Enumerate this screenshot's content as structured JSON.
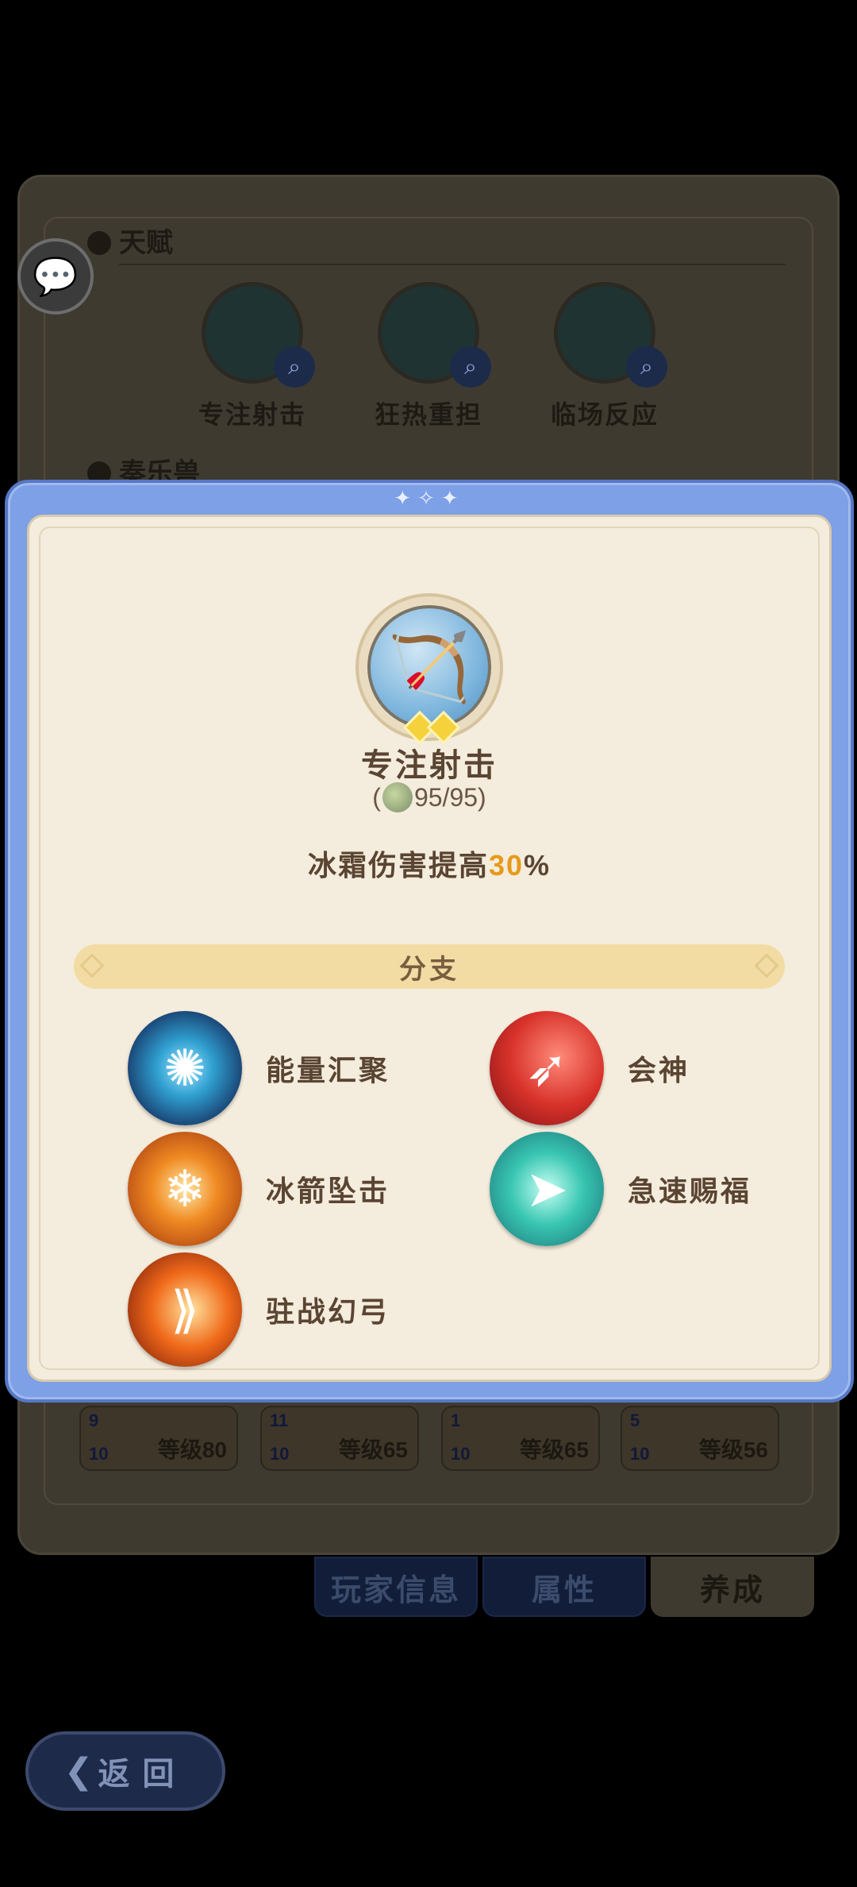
{
  "background": {
    "section_talent": "天赋",
    "section_music": "奏乐兽",
    "talents": [
      {
        "name": "专注射击",
        "icon": "bow-icon"
      },
      {
        "name": "狂热重担",
        "icon": "eye-shield-icon"
      },
      {
        "name": "临场反应",
        "icon": "arrow-diamond-icon"
      }
    ],
    "cards": [
      {
        "n1": "9",
        "n2": "10",
        "level": "等级80"
      },
      {
        "n1": "11",
        "n2": "10",
        "level": "等级65"
      },
      {
        "n1": "1",
        "n2": "10",
        "level": "等级65"
      },
      {
        "n1": "5",
        "n2": "10",
        "level": "等级56"
      }
    ],
    "tabs": [
      "玩家信息",
      "属性",
      "养成"
    ],
    "back_label": "返回"
  },
  "modal": {
    "skill_name": "专注射击",
    "progress_open": "(",
    "progress": "95/95",
    "progress_close": ")",
    "desc_prefix": "冰霜伤害提高",
    "desc_value": "30",
    "desc_suffix": "%",
    "branch_title": "分支",
    "branches": [
      {
        "label": "能量汇聚",
        "icon": "energy-gather-icon"
      },
      {
        "label": "会神",
        "icon": "archer-focus-icon"
      },
      {
        "label": "冰箭坠击",
        "icon": "ice-arrow-strike-icon"
      },
      {
        "label": "急速赐福",
        "icon": "swift-blessing-icon"
      },
      {
        "label": "驻战幻弓",
        "icon": "phantom-bow-icon"
      }
    ]
  },
  "colors": {
    "modal_border": "#7da0e6",
    "modal_bg": "#f4ecdc",
    "highlight": "#e69a1a",
    "text_brown": "#5a4432"
  }
}
